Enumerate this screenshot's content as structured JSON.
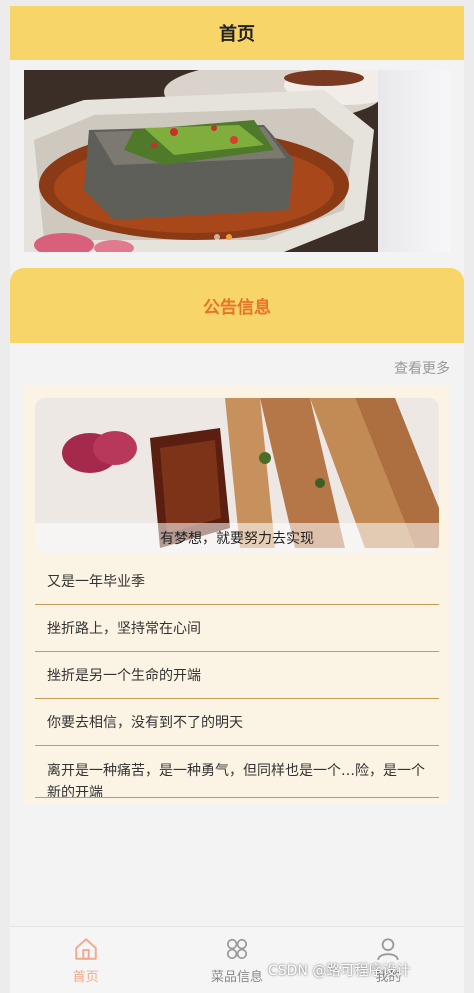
{
  "header": {
    "title": "首页"
  },
  "banner": {
    "dot_count": 2,
    "active_dot": 1
  },
  "notice": {
    "title": "公告信息",
    "more_label": "查看更多"
  },
  "news": {
    "caption": "有梦想，就要努力去实现",
    "items": [
      "又是一年毕业季",
      "挫折路上，坚持常在心间",
      "挫折是另一个生命的开端",
      "你要去相信，没有到不了的明天",
      "离开是一种痛苦，是一种勇气，但同样也是一个…险，是一个新的开端"
    ]
  },
  "tabbar": {
    "items": [
      {
        "label": "首页",
        "icon": "home-icon",
        "active": true
      },
      {
        "label": "菜品信息",
        "icon": "grid-icon",
        "active": false
      },
      {
        "label": "我的",
        "icon": "user-icon",
        "active": false
      }
    ]
  },
  "watermark": "CSDN @路可程序设计",
  "colors": {
    "header": "#f7d569",
    "accent": "#e8742a",
    "tab_active": "#f2a98f",
    "divider": "#c49a55"
  }
}
